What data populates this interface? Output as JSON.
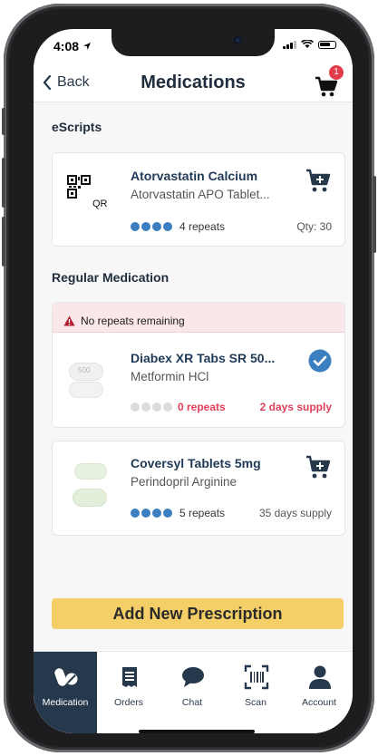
{
  "status": {
    "time": "4:08"
  },
  "nav": {
    "back_label": "Back",
    "title": "Medications",
    "cart_badge": "1"
  },
  "escripts": {
    "section_title": "eScripts",
    "items": [
      {
        "name": "Atorvastatin Calcium",
        "sub": "Atorvastatin APO Tablet...",
        "qr_label": "QR",
        "repeats": "4 repeats",
        "qty": "Qty: 30",
        "repeats_count": 4
      }
    ]
  },
  "regular": {
    "section_title": "Regular Medication",
    "warning": "No repeats remaining",
    "items": [
      {
        "name": "Diabex XR Tabs SR 50...",
        "sub": "Metformin HCl",
        "repeats": "0 repeats",
        "supply": "2 days supply",
        "repeats_count": 0,
        "pill_text": "500"
      },
      {
        "name": "Coversyl Tablets 5mg",
        "sub": "Perindopril Arginine",
        "repeats": "5 repeats",
        "supply": "35 days supply",
        "repeats_count": 4
      }
    ]
  },
  "add_button": "Add New Prescription",
  "tabs": [
    {
      "label": "Medication",
      "icon": "pill-icon",
      "active": true
    },
    {
      "label": "Orders",
      "icon": "receipt-icon",
      "active": false
    },
    {
      "label": "Chat",
      "icon": "chat-bubble-icon",
      "active": false
    },
    {
      "label": "Scan",
      "icon": "barcode-scan-icon",
      "active": false
    },
    {
      "label": "Account",
      "icon": "person-icon",
      "active": false
    }
  ],
  "colors": {
    "accent": "#26384c",
    "dot_blue": "#3c7fc1",
    "warning_red": "#e0405a",
    "button_yellow": "#f4cf67"
  }
}
